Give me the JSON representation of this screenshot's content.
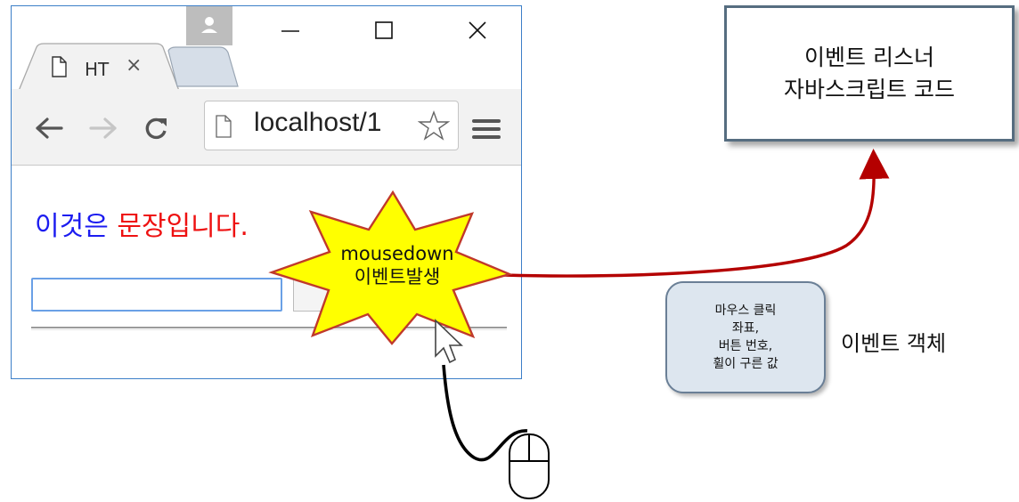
{
  "browser": {
    "tab_title": "HT",
    "tab_close": "×",
    "address": "localhost/1",
    "window_controls": [
      "minimize-icon",
      "maximize-icon",
      "close-icon"
    ]
  },
  "page": {
    "sentence_part1": "이것은 ",
    "sentence_part2": "문장입니다."
  },
  "burst": {
    "line1": "mousedown",
    "line2": "이벤트발생",
    "fill_color": "#ffff00",
    "border_color": "#c0392b"
  },
  "listener": {
    "line1": "이벤트 리스너",
    "line2": "자바스크립트 코드"
  },
  "event_object": {
    "lines": [
      "마우스 클릭",
      "좌표,",
      "버튼 번호,",
      "휠이 구른 값"
    ],
    "label": "이벤트 객체"
  },
  "colors": {
    "arrow": "#b40000",
    "browser_border": "#3c7fc8"
  }
}
